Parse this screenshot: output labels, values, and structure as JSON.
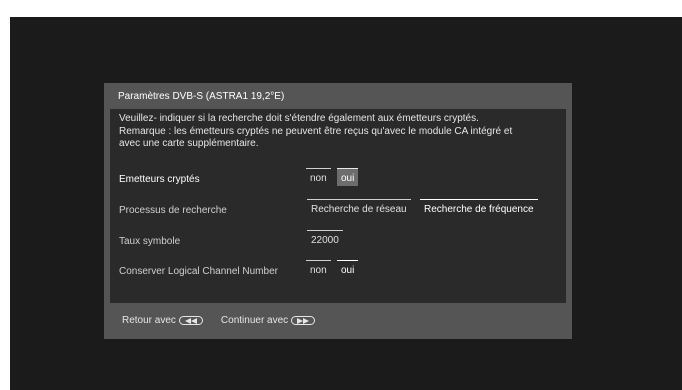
{
  "dialog": {
    "title": "Paramètres DVB-S (ASTRA1 19,2°E)",
    "note_lines": [
      "Veuillez- indiquer si la recherche doit s'étendre également  aux émetteurs cryptés.",
      "Remarque : les émetteurs cryptés ne peuvent être reçus qu'avec le module CA intégré et",
      "avec une carte supplémentaire."
    ],
    "rows": {
      "encrypted": {
        "label": "Emetteurs cryptés",
        "options": [
          "non",
          "oui"
        ],
        "selected": "oui"
      },
      "search_process": {
        "label": "Processus de recherche",
        "options": [
          "Recherche de réseau",
          "Recherche de fréquence"
        ],
        "selected": "Recherche de fréquence"
      },
      "symbol_rate": {
        "label": "Taux symbole",
        "value": "22000"
      },
      "lcn": {
        "label": "Conserver Logical Channel Number",
        "options": [
          "non",
          "oui"
        ],
        "selected": "oui"
      }
    },
    "footer": {
      "back_label": "Retour avec",
      "back_icon": "rewind-button-icon",
      "continue_label": "Continuer avec",
      "continue_icon": "fast-forward-button-icon"
    }
  }
}
